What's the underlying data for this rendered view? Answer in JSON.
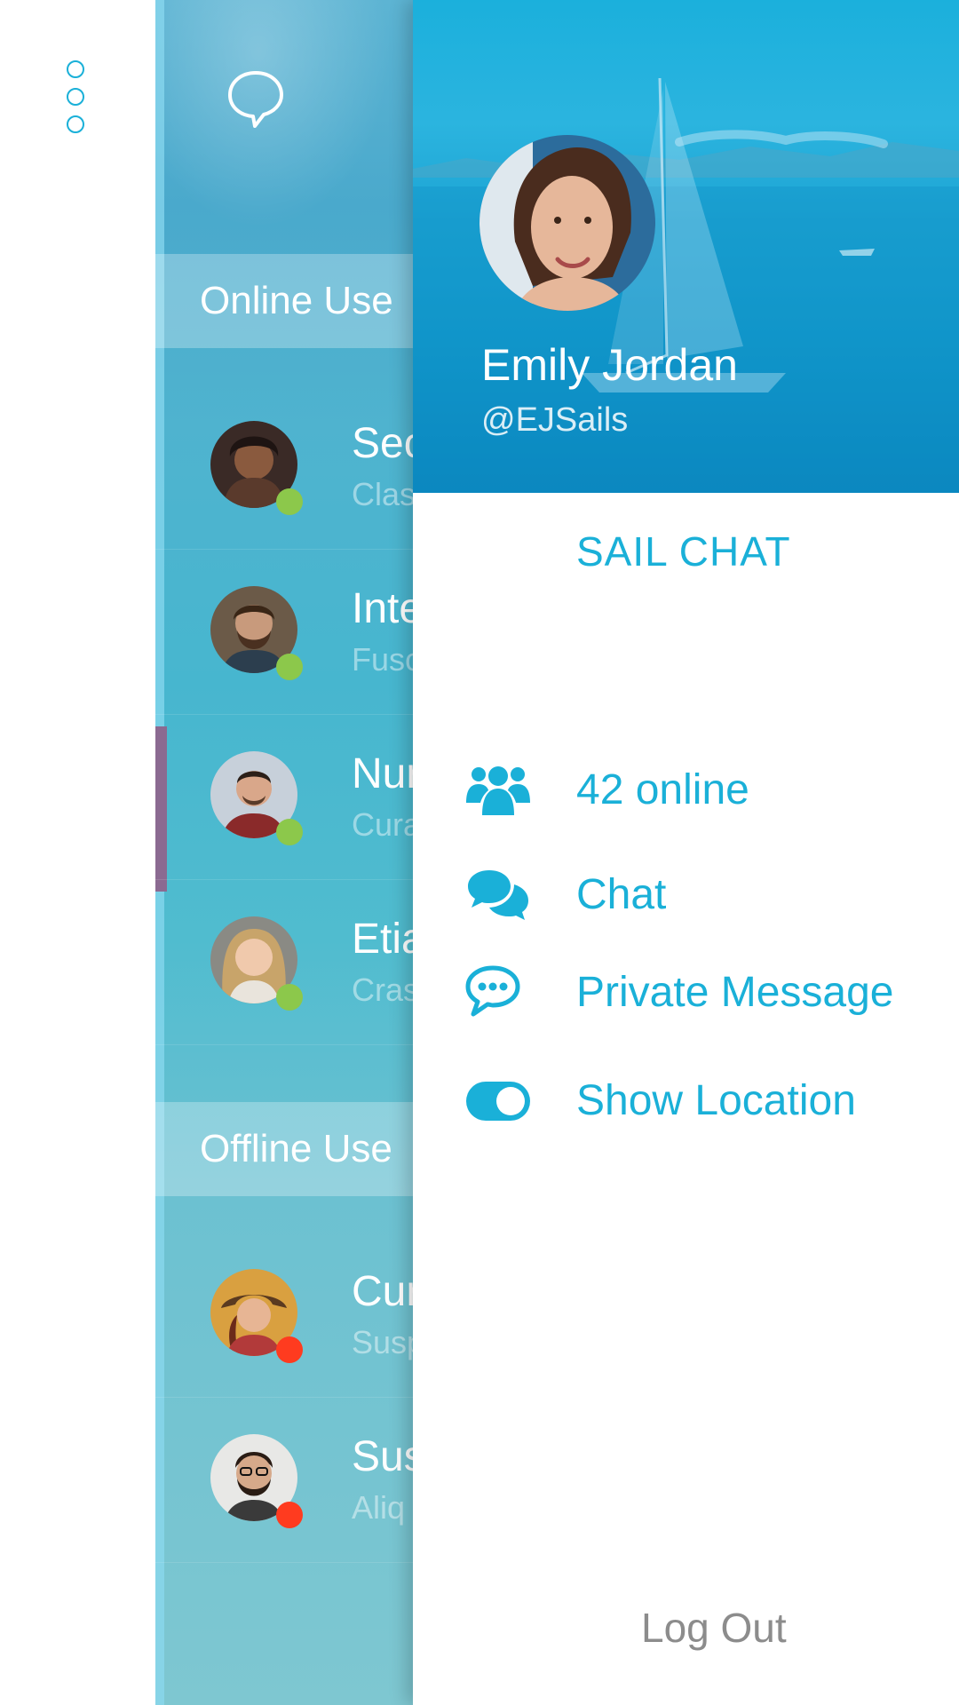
{
  "colors": {
    "accent": "#1ab0d8",
    "online": "#8cc84b",
    "offline": "#ff3b1f"
  },
  "rail": {
    "menu_icon": "vertical-dots-icon"
  },
  "list": {
    "top_icon": "chat-bubble-icon",
    "online_header": "Online Use",
    "offline_header": "Offline Use",
    "online_users": [
      {
        "name": "Sec",
        "message": "Clas",
        "status": "online"
      },
      {
        "name": "Inte",
        "message": "Fusc",
        "status": "online"
      },
      {
        "name": "Nur",
        "message": "Cura",
        "status": "online"
      },
      {
        "name": "Etia",
        "message": "Cras",
        "status": "online"
      }
    ],
    "offline_users": [
      {
        "name": "Cur",
        "message": "Susp",
        "status": "offline"
      },
      {
        "name": "Sus",
        "message": "Aliq",
        "status": "offline"
      }
    ]
  },
  "drawer": {
    "profile": {
      "name": "Emily Jordan",
      "handle": "@EJSails"
    },
    "app_title": "SAIL CHAT",
    "menu": [
      {
        "label": "42 online",
        "icon": "users-icon"
      },
      {
        "label": "Chat",
        "icon": "chat-bubbles-icon"
      },
      {
        "label": "Private Message",
        "icon": "private-message-icon"
      },
      {
        "label": "Show Location",
        "icon": "toggle-on-icon"
      }
    ],
    "logout": "Log Out"
  }
}
